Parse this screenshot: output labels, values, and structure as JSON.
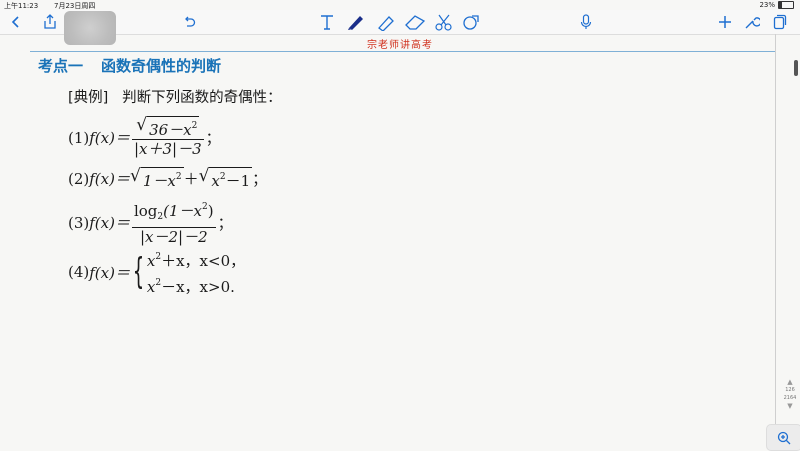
{
  "status": {
    "time": "上午11:23",
    "date": "7月23日周四",
    "battery": "23%"
  },
  "toolbar": {
    "left_icons": [
      "back-icon",
      "share-icon",
      "undo-icon"
    ],
    "tool_icons": [
      "text-tool-icon",
      "pen-icon",
      "highlighter-icon",
      "eraser-icon",
      "lasso-scissors-icon",
      "shapes-icon"
    ],
    "right_icons": [
      "mic-icon",
      "add-icon",
      "wrench-icon",
      "pages-icon"
    ]
  },
  "page_header": "宗老师讲高考",
  "section": {
    "label": "考点一",
    "title": "函数奇偶性的判断"
  },
  "example": {
    "tag": "[典例]",
    "prompt": "判断下列函数的奇偶性："
  },
  "problems": {
    "p1": {
      "label": "(1)",
      "num_radicand": "36－x",
      "den": "|x＋3|－3"
    },
    "p2": {
      "label": "(2)",
      "rad1": "1－x",
      "rad2": "x",
      "rad2_tail": "－1"
    },
    "p3": {
      "label": "(3)",
      "num": "log",
      "num_base": "2",
      "num_arg": "(1－x",
      "num_close": ")",
      "den": "|x－2|－2"
    },
    "p4": {
      "label": "(4)",
      "case1": "x",
      "case1_tail": "＋x，x<0，",
      "case2": "x",
      "case2_tail": "－x，x>0."
    }
  },
  "func_prefix": "f(x)＝",
  "pager": {
    "current": "126",
    "total": "2164"
  },
  "colors": {
    "header": "#d0301d",
    "section": "#1a73b8",
    "accent": "#1f6fd1"
  }
}
